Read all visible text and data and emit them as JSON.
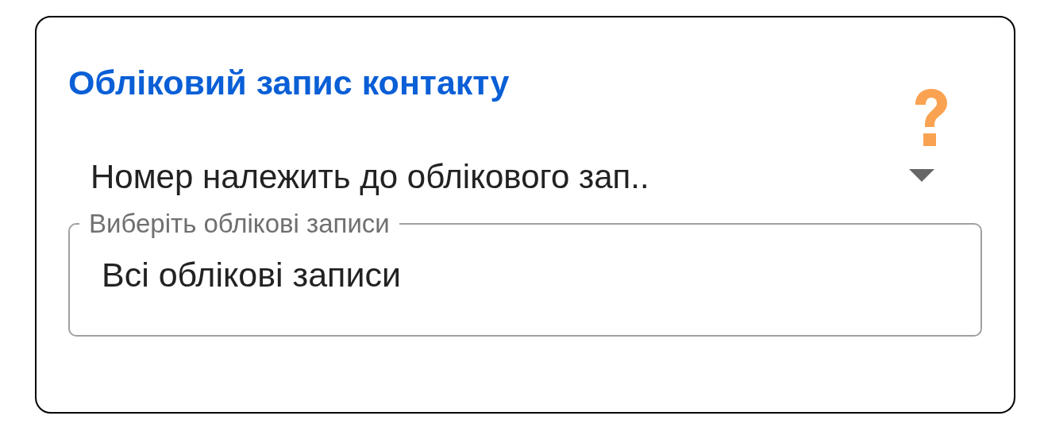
{
  "card": {
    "title": "Обліковий запис контакту",
    "dropdown": {
      "value": "Номер належить до облікового зап.."
    },
    "accounts_field": {
      "label": "Виберіть облікові записи",
      "value": "Всі облікові записи"
    }
  }
}
